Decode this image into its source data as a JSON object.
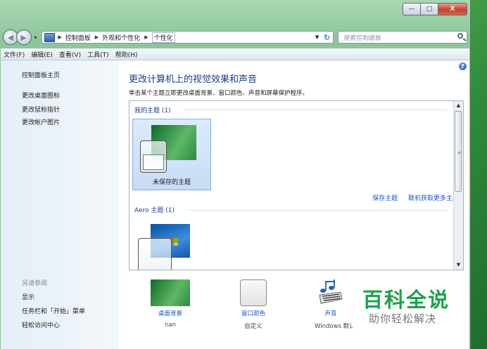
{
  "window": {
    "caption": {
      "minimize": "—",
      "maximize": "□",
      "close": "X"
    }
  },
  "navigation": {
    "back": "◀",
    "forward": "▶",
    "breadcrumbs": [
      "控制面板",
      "外观和个性化",
      "个性化"
    ],
    "search_placeholder": "搜索控制面板"
  },
  "menubar": {
    "items": [
      "文件(F)",
      "编辑(E)",
      "查看(V)",
      "工具(T)",
      "帮助(H)"
    ]
  },
  "sidebar": {
    "home_link": "控制面板主页",
    "links": [
      "更改桌面图标",
      "更改鼠标指针",
      "更改帐户图片"
    ],
    "see_also_title": "另请参阅",
    "see_also": [
      "显示",
      "任务栏和「开始」菜单",
      "轻松访问中心"
    ]
  },
  "main": {
    "heading": "更改计算机上的视觉效果和声音",
    "subtitle": "单击某个主题立即更改桌面背景、窗口颜色、声音和屏幕保护程序。",
    "my_themes_header": "我的主题 (1)",
    "unsaved_theme_label": "未保存的主题",
    "save_theme_link": "保存主题",
    "get_more_link": "联机获取更多主题",
    "aero_header": "Aero 主题 (1)"
  },
  "bottom": {
    "items": [
      {
        "label": "桌面背景",
        "value": "nan"
      },
      {
        "label": "窗口颜色",
        "value": "自定义"
      },
      {
        "label": "声音",
        "value": "Windows 默认"
      }
    ]
  },
  "watermark": {
    "title": "百科全说",
    "subtitle": "助你轻松解决"
  },
  "colors": {
    "link": "#1a56c2",
    "heading": "#1d3c8c",
    "watermark": "#1aa34a"
  }
}
